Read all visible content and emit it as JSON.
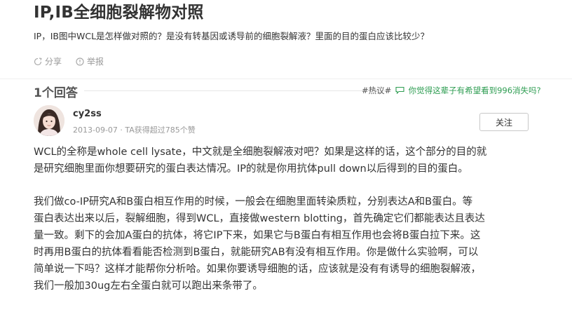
{
  "question": {
    "title": "IP,IB全细胞裂解物对照",
    "description": "IP，IB图中WCL是怎样做对照的？是没有转基因或诱导前的细胞裂解液？里面的目的蛋白应该比较少？",
    "actions": [
      {
        "label": "分享",
        "icon": "share-icon"
      },
      {
        "label": "举报",
        "icon": "report-icon"
      }
    ]
  },
  "answers": {
    "count_label": "1个回答",
    "hot_tag": "#热议#",
    "hot_link": "你觉得这辈子有希望看到996消失吗?"
  },
  "answer": {
    "author": "cy2ss",
    "meta": "2013-09-07 · TA获得超过785个赞",
    "follow_label": "关注",
    "p1_lines": [
      "WCL的全称是whole cell lysate，中文就是全细胞裂解液对吧？如果是这样的话，这个部分的目的就",
      "是研究细胞里面你想要研究的蛋白表达情况。IP的就是你用抗体pull down以后得到的目的蛋白。"
    ],
    "p2_lines": [
      "我们做co-IP研究A和B蛋白相互作用的时候，一般会在细胞里面转染质粒，分别表达A和B蛋白。等",
      "蛋白表达出来以后，裂解细胞，得到WCL，直接做western blotting，首先确定它们都能表达且表达",
      "量一致。剩下的会加A蛋白的抗体，将它IP下来，如果它与B蛋白有相互作用也会将B蛋白拉下来。这",
      "时再用B蛋白的抗体看看能否检测到B蛋白，就能研究AB有没有相互作用。你是做什么实验啊，可以",
      "简单说一下吗？这样才能帮你分析哈。如果你要诱导细胞的话，应该就是没有有诱导的细胞裂解液，",
      "我们一般加30ug左右全蛋白就可以跑出来条带了。"
    ]
  }
}
